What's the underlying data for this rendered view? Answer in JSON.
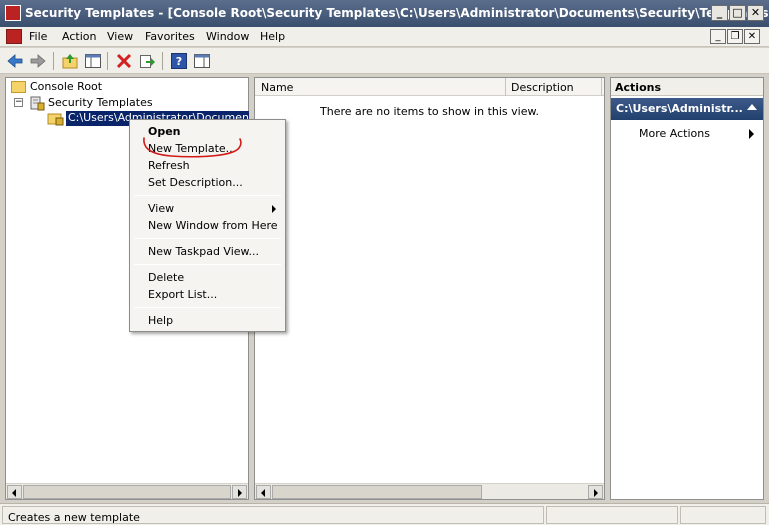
{
  "window": {
    "title": "Security Templates - [Console Root\\Security Templates\\C:\\Users\\Administrator\\Documents\\Security\\Templates]",
    "minimize_glyph": "_",
    "maximize_glyph": "□",
    "close_glyph": "✕"
  },
  "menu": {
    "items": [
      "File",
      "Action",
      "View",
      "Favorites",
      "Window",
      "Help"
    ],
    "mdi_minimize": "_",
    "mdi_restore": "❐",
    "mdi_close": "✕"
  },
  "toolbar": {
    "icons": [
      "back-icon",
      "forward-icon",
      "up-folder-icon",
      "show-hide-tree-icon",
      "delete-icon",
      "export-list-icon",
      "help-icon",
      "show-hide-action-pane-icon"
    ]
  },
  "tree": {
    "root": "Console Root",
    "child": "Security Templates",
    "selected": "C:\\Users\\Administrator\\Documents\\Se",
    "expander_glyph": "−"
  },
  "list": {
    "columns": [
      "Name",
      "Description"
    ],
    "empty_message": "There are no items to show in this view."
  },
  "actions": {
    "header": "Actions",
    "group": "C:\\Users\\Administr...",
    "items": [
      "More Actions"
    ]
  },
  "context_menu": {
    "items": [
      "Open",
      "New Template...",
      "Refresh",
      "Set Description...",
      "View",
      "New Window from Here",
      "New Taskpad View...",
      "Delete",
      "Export List...",
      "Help"
    ]
  },
  "status": {
    "text": "Creates a new template"
  },
  "colors": {
    "titlebar": "#3a4e6e",
    "selection": "#0a246a",
    "annotation": "#d11a1a"
  }
}
